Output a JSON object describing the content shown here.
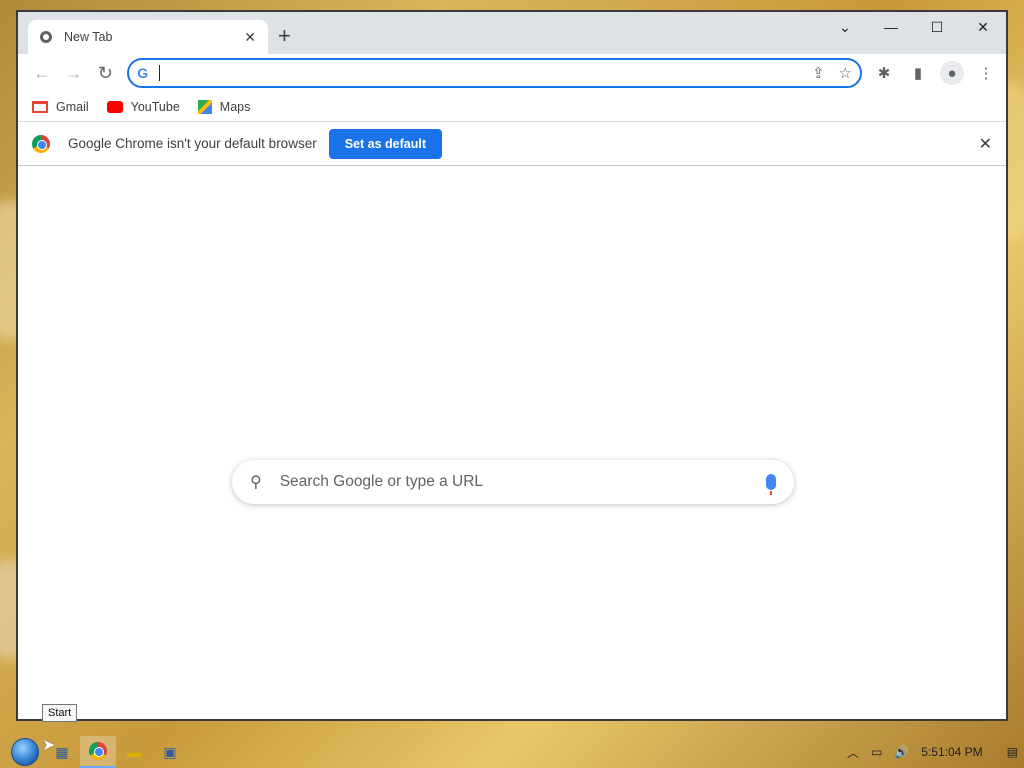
{
  "window": {
    "tab_title": "New Tab",
    "tab_close": "✕",
    "new_tab": "+",
    "controls": {
      "dropdown": "⌄",
      "minimize": "—",
      "maximize": "☐",
      "close": "✕"
    }
  },
  "toolbar": {
    "omnibox_value": "",
    "omnibox_g": "G"
  },
  "bookmarks": [
    {
      "label": "Gmail",
      "icon": "gmail-icon",
      "color": "#ea4335"
    },
    {
      "label": "YouTube",
      "icon": "youtube-icon",
      "color": "#ff0000"
    },
    {
      "label": "Maps",
      "icon": "maps-icon",
      "color": "#34a853"
    }
  ],
  "infobar": {
    "message": "Google Chrome isn't your default browser",
    "button": "Set as default"
  },
  "ntp": {
    "search_placeholder": "Search Google or type a URL"
  },
  "taskbar": {
    "clock": "5:51:04 PM",
    "tooltip": "Start"
  },
  "colors": {
    "accent": "#1a73e8",
    "tab_strip": "#dee1e6"
  }
}
